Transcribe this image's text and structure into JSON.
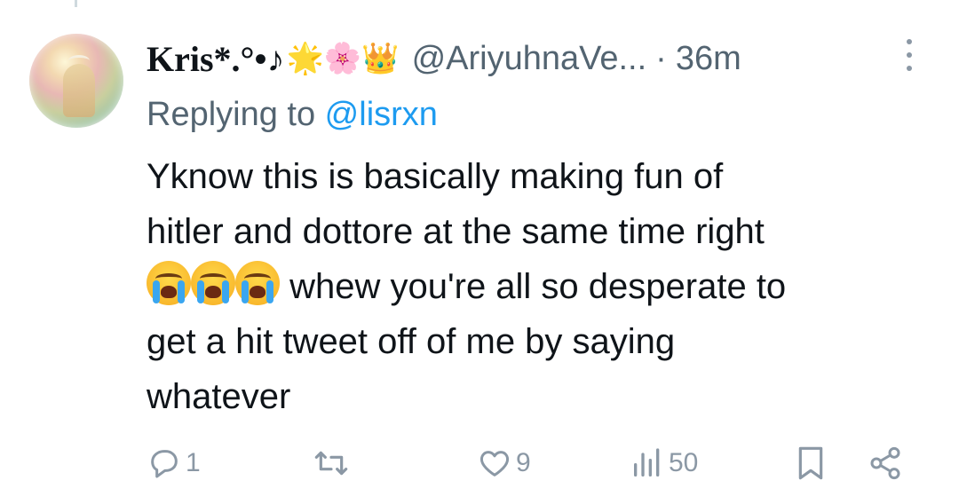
{
  "tweet": {
    "display_name": "Kris*.°•♪",
    "name_emoji": "🌟🌸👑",
    "handle": "@AriyuhnaVe...",
    "separator": "·",
    "time": "36m",
    "replying_prefix": "Replying to ",
    "replying_to": "@lisrxn",
    "text_line1": "Yknow this is basically making fun of",
    "text_line2": "hitler and dottore at the same time right",
    "text_line3": " whew you're all so desperate to",
    "text_line4": "get a hit tweet off of me by saying",
    "text_line5": "whatever",
    "emoji_names": [
      "crying-face-icon",
      "crying-face-icon",
      "crying-face-icon"
    ]
  },
  "actions": {
    "reply_count": "1",
    "retweet_count": "",
    "like_count": "9",
    "views_count": "50"
  },
  "colors": {
    "text": "#0f1419",
    "muted": "#536471",
    "icon": "#8b98a5",
    "link": "#1d9bf0"
  }
}
